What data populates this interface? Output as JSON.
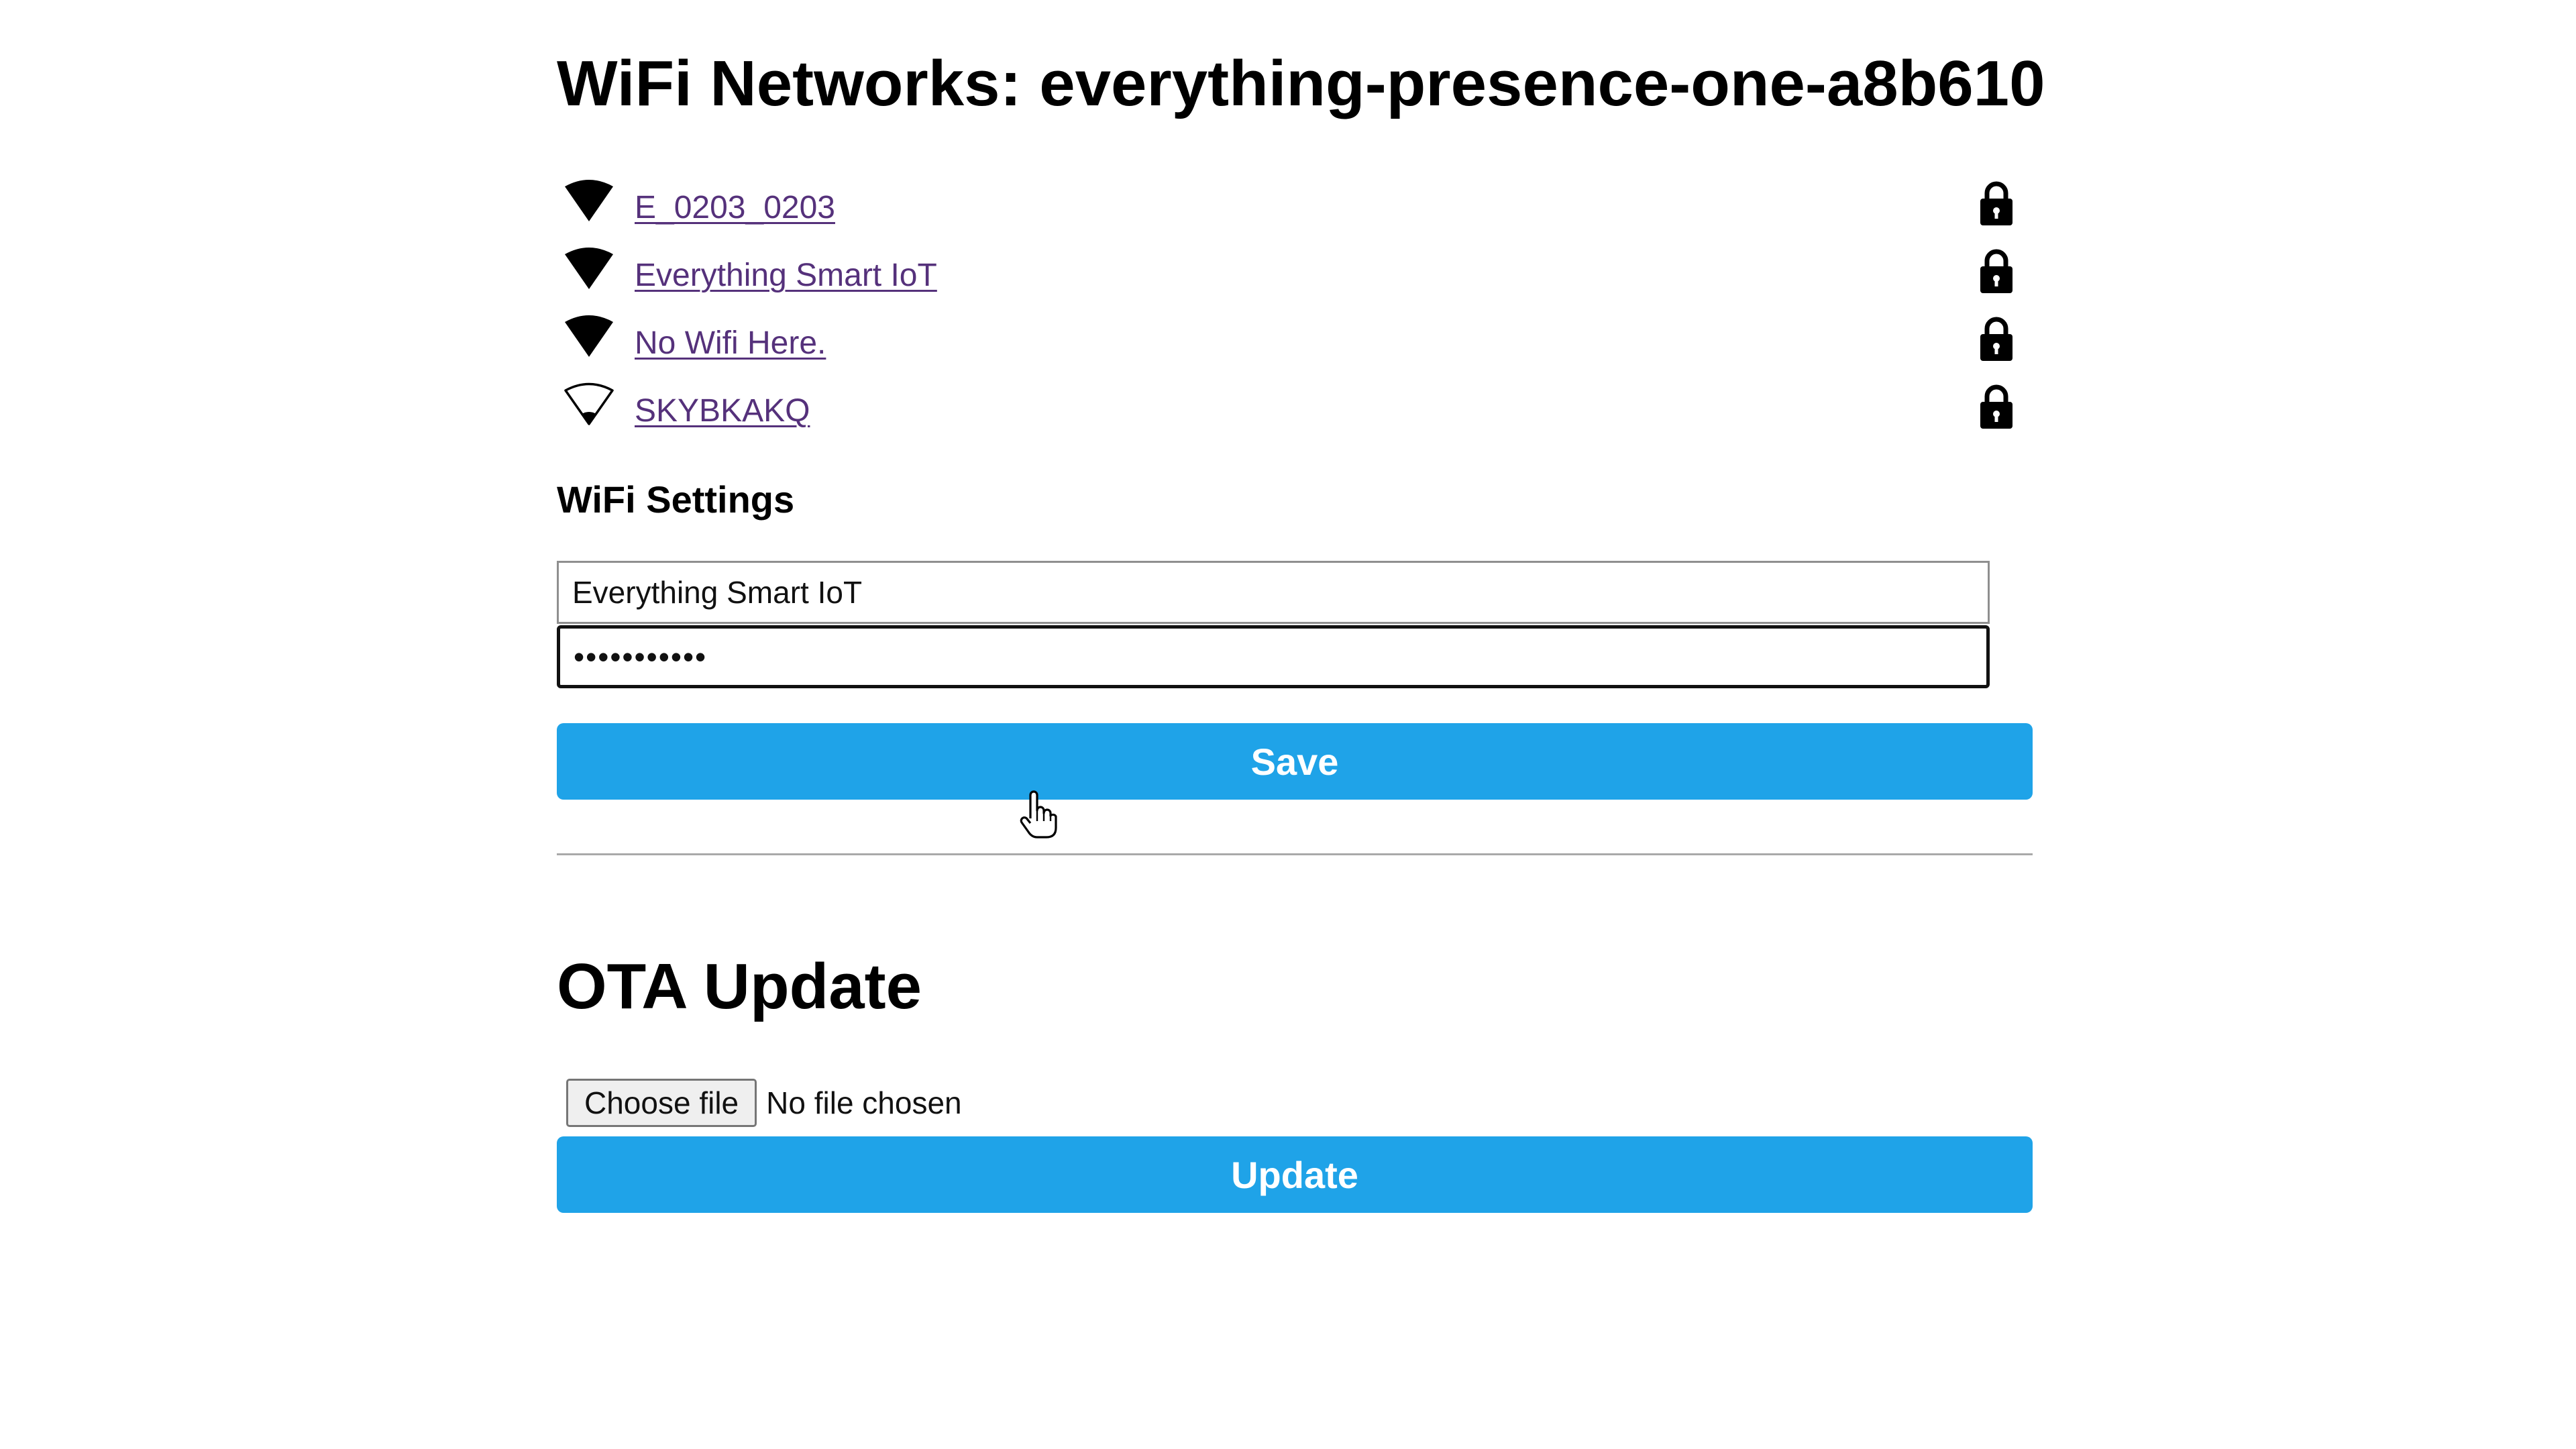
{
  "page": {
    "title": "WiFi Networks: everything-presence-one-a8b610"
  },
  "networks": [
    {
      "ssid": "E_0203_0203",
      "signal": "strong",
      "secured": true
    },
    {
      "ssid": "Everything Smart IoT",
      "signal": "strong",
      "secured": true
    },
    {
      "ssid": "No Wifi Here.",
      "signal": "strong",
      "secured": true
    },
    {
      "ssid": "SKYBKAKQ",
      "signal": "weak",
      "secured": true
    }
  ],
  "icons": {
    "signal": "wifi-signal-icon",
    "secured": "lock-icon",
    "pointer": "hand-pointer-icon"
  },
  "wifi_settings": {
    "heading": "WiFi Settings",
    "ssid_value": "Everything Smart IoT",
    "password_value": "•••••••••••",
    "save_label": "Save"
  },
  "ota": {
    "heading": "OTA Update",
    "choose_file_label": "Choose file",
    "file_status": "No file chosen",
    "update_label": "Update"
  },
  "colors": {
    "button": "#1fa3e8",
    "link_visited": "#55317b",
    "divider": "#a9a9a9"
  }
}
